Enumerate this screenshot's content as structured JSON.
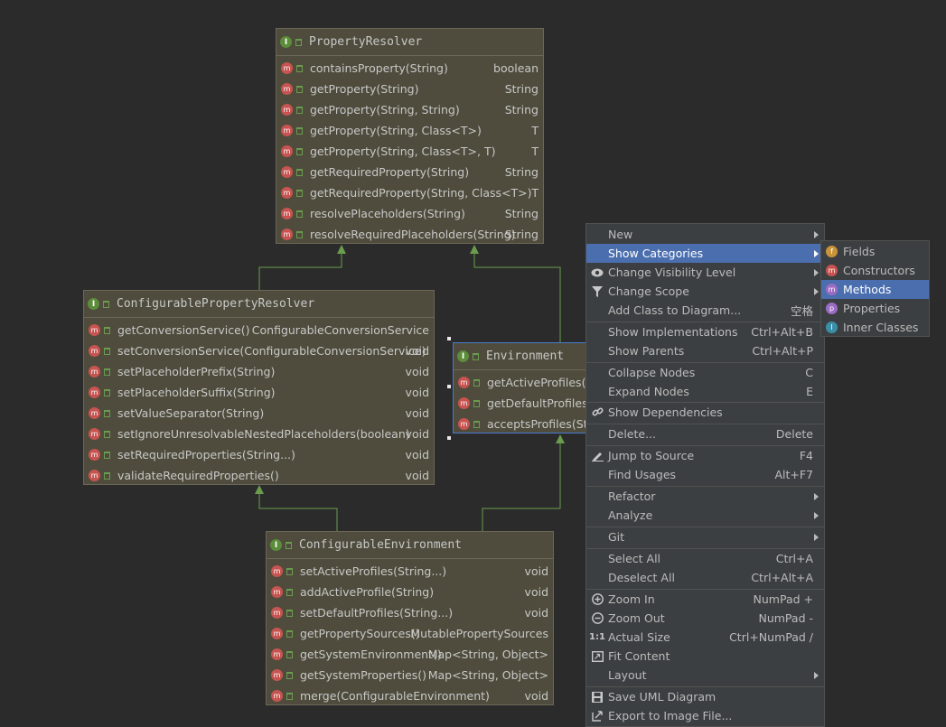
{
  "colors": {
    "background": "#2b2b2b",
    "node_fill": "#4f4c3d",
    "edge": "#6a9c4e",
    "menu_bg": "#3c3f41",
    "menu_highlight": "#4b6eaf"
  },
  "classes": {
    "property_resolver": {
      "title": "PropertyResolver",
      "methods": [
        {
          "name": "containsProperty(String)",
          "ret": "boolean"
        },
        {
          "name": "getProperty(String)",
          "ret": "String"
        },
        {
          "name": "getProperty(String, String)",
          "ret": "String"
        },
        {
          "name": "getProperty(String, Class<T>)",
          "ret": "T"
        },
        {
          "name": "getProperty(String, Class<T>, T)",
          "ret": "T"
        },
        {
          "name": "getRequiredProperty(String)",
          "ret": "String"
        },
        {
          "name": "getRequiredProperty(String, Class<T>)",
          "ret": "T"
        },
        {
          "name": "resolvePlaceholders(String)",
          "ret": "String"
        },
        {
          "name": "resolveRequiredPlaceholders(String)",
          "ret": "String"
        }
      ]
    },
    "configurable_property_resolver": {
      "title": "ConfigurablePropertyResolver",
      "methods": [
        {
          "name": "getConversionService()",
          "ret": "ConfigurableConversionService"
        },
        {
          "name": "setConversionService(ConfigurableConversionService)",
          "ret": "void"
        },
        {
          "name": "setPlaceholderPrefix(String)",
          "ret": "void"
        },
        {
          "name": "setPlaceholderSuffix(String)",
          "ret": "void"
        },
        {
          "name": "setValueSeparator(String)",
          "ret": "void"
        },
        {
          "name": "setIgnoreUnresolvableNestedPlaceholders(boolean)",
          "ret": "void"
        },
        {
          "name": "setRequiredProperties(String...)",
          "ret": "void"
        },
        {
          "name": "validateRequiredProperties()",
          "ret": "void"
        }
      ]
    },
    "environment": {
      "title": "Environment",
      "methods": [
        {
          "name": "getActiveProfiles()",
          "ret": ""
        },
        {
          "name": "getDefaultProfiles(",
          "ret": ""
        },
        {
          "name": "acceptsProfiles(Str",
          "ret": ""
        }
      ]
    },
    "configurable_environment": {
      "title": "ConfigurableEnvironment",
      "methods": [
        {
          "name": "setActiveProfiles(String...)",
          "ret": "void"
        },
        {
          "name": "addActiveProfile(String)",
          "ret": "void"
        },
        {
          "name": "setDefaultProfiles(String...)",
          "ret": "void"
        },
        {
          "name": "getPropertySources()",
          "ret": "MutablePropertySources"
        },
        {
          "name": "getSystemEnvironment()",
          "ret": "Map<String, Object>"
        },
        {
          "name": "getSystemProperties()",
          "ret": "Map<String, Object>"
        },
        {
          "name": "merge(ConfigurableEnvironment)",
          "ret": "void"
        }
      ]
    }
  },
  "badges": {
    "interface": "I",
    "method": "m"
  },
  "context_menu": {
    "items": [
      {
        "label": "New",
        "shortcut": "",
        "submenu": true,
        "icon": ""
      },
      {
        "label": "Show Categories",
        "shortcut": "",
        "submenu": true,
        "icon": "",
        "highlighted": true
      },
      {
        "label": "Change Visibility Level",
        "shortcut": "",
        "submenu": true,
        "icon": "eye-icon"
      },
      {
        "label": "Change Scope",
        "shortcut": "",
        "submenu": true,
        "icon": "filter-icon"
      },
      {
        "label": "Add Class to Diagram...",
        "shortcut": "空格",
        "submenu": false,
        "icon": ""
      },
      {
        "label": "Show Implementations",
        "shortcut": "Ctrl+Alt+B",
        "submenu": false,
        "icon": ""
      },
      {
        "label": "Show Parents",
        "shortcut": "Ctrl+Alt+P",
        "submenu": false,
        "icon": ""
      },
      {
        "label": "Collapse Nodes",
        "shortcut": "C",
        "submenu": false,
        "icon": ""
      },
      {
        "label": "Expand Nodes",
        "shortcut": "E",
        "submenu": false,
        "icon": ""
      },
      {
        "label": "Show Dependencies",
        "shortcut": "",
        "submenu": false,
        "icon": "link-icon"
      },
      {
        "label": "Delete...",
        "shortcut": "Delete",
        "submenu": false,
        "icon": ""
      },
      {
        "label": "Jump to Source",
        "shortcut": "F4",
        "submenu": false,
        "icon": "pencil-icon"
      },
      {
        "label": "Find Usages",
        "shortcut": "Alt+F7",
        "submenu": false,
        "icon": ""
      },
      {
        "label": "Refactor",
        "shortcut": "",
        "submenu": true,
        "icon": ""
      },
      {
        "label": "Analyze",
        "shortcut": "",
        "submenu": true,
        "icon": ""
      },
      {
        "label": "Git",
        "shortcut": "",
        "submenu": true,
        "icon": ""
      },
      {
        "label": "Select All",
        "shortcut": "Ctrl+A",
        "submenu": false,
        "icon": ""
      },
      {
        "label": "Deselect All",
        "shortcut": "Ctrl+Alt+A",
        "submenu": false,
        "icon": ""
      },
      {
        "label": "Zoom In",
        "shortcut": "NumPad +",
        "submenu": false,
        "icon": "zoom-in-icon"
      },
      {
        "label": "Zoom Out",
        "shortcut": "NumPad -",
        "submenu": false,
        "icon": "zoom-out-icon"
      },
      {
        "label": "Actual Size",
        "shortcut": "Ctrl+NumPad /",
        "submenu": false,
        "icon": "actual-size-icon"
      },
      {
        "label": "Fit Content",
        "shortcut": "",
        "submenu": false,
        "icon": "fit-content-icon"
      },
      {
        "label": "Layout",
        "shortcut": "",
        "submenu": true,
        "icon": ""
      },
      {
        "label": "Save UML Diagram",
        "shortcut": "",
        "submenu": false,
        "icon": "save-icon"
      },
      {
        "label": "Export to Image File...",
        "shortcut": "",
        "submenu": false,
        "icon": "export-icon"
      }
    ]
  },
  "categories_submenu": {
    "items": [
      {
        "label": "Fields",
        "badge": "f",
        "color": "#c9933a"
      },
      {
        "label": "Constructors",
        "badge": "m",
        "color": "#c75450"
      },
      {
        "label": "Methods",
        "badge": "m",
        "color": "#9b6cc4",
        "highlighted": true
      },
      {
        "label": "Properties",
        "badge": "p",
        "color": "#9b6cc4"
      },
      {
        "label": "Inner Classes",
        "badge": "I",
        "color": "#3a8fa8"
      }
    ]
  }
}
